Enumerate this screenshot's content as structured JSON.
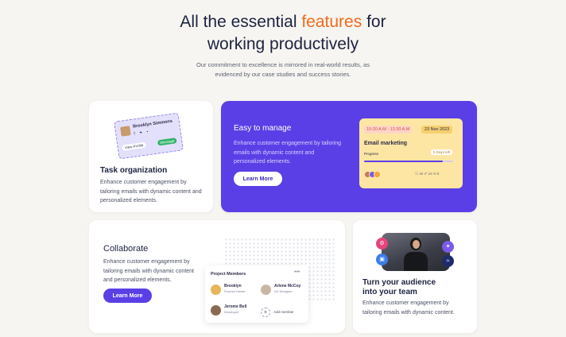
{
  "hero": {
    "title_part1": "All the essential ",
    "title_accent": "features",
    "title_part2": " for",
    "title_line2": "working productively",
    "subtitle_line1": "Our commitment to excellence is mirrored in real-world results, as",
    "subtitle_line2": "evidenced by our case studies and success stories."
  },
  "colors": {
    "accent": "#f26a1b",
    "primary": "#5b3fe6",
    "navy": "#1c2340"
  },
  "task_card": {
    "title": "Task organization",
    "description": "Enhance customer engagement by tailoring emails with dynamic content and personalized elements.",
    "profile_name": "Brooklyn Simmons",
    "profile_icons": "f ✦ •",
    "tag_left": "View Profile",
    "tag_right": "Message"
  },
  "easy_card": {
    "title": "Easy to manage",
    "description": "Enhance customer engagement by tailoring emails with dynamic content and personalized elements.",
    "button": "Learn More",
    "email": {
      "time": "10:30 A.M - 12:30 A.M",
      "date": "23 Nov 2023",
      "title": "Email marketing",
      "progress_label": "Progress",
      "due_label": "5 Days left",
      "progress": 0.88,
      "stats": "☷ 45   ✐ 15   ✉ 8"
    }
  },
  "collab_card": {
    "title": "Collaborate",
    "description": "Enhance customer engagement by tailoring emails with dynamic content and personalized elements.",
    "button": "Learn More",
    "members_title": "Project Members",
    "members_menu": "•••",
    "members": [
      {
        "name": "Brooklyn",
        "role": "Product Owner"
      },
      {
        "name": "Arlene McCoy",
        "role": "UX Designer"
      },
      {
        "name": "Jerome Bell",
        "role": "Developer"
      }
    ],
    "add_member_label": "Add member",
    "add_member_icon": "+"
  },
  "turn_card": {
    "title_line1": "Turn your audience",
    "title_line2": "into your team",
    "description": "Enhance customer engagement by tailoring emails with dynamic content.",
    "bubble_icons": [
      "⚙",
      "✦",
      "▣",
      "≈"
    ]
  }
}
